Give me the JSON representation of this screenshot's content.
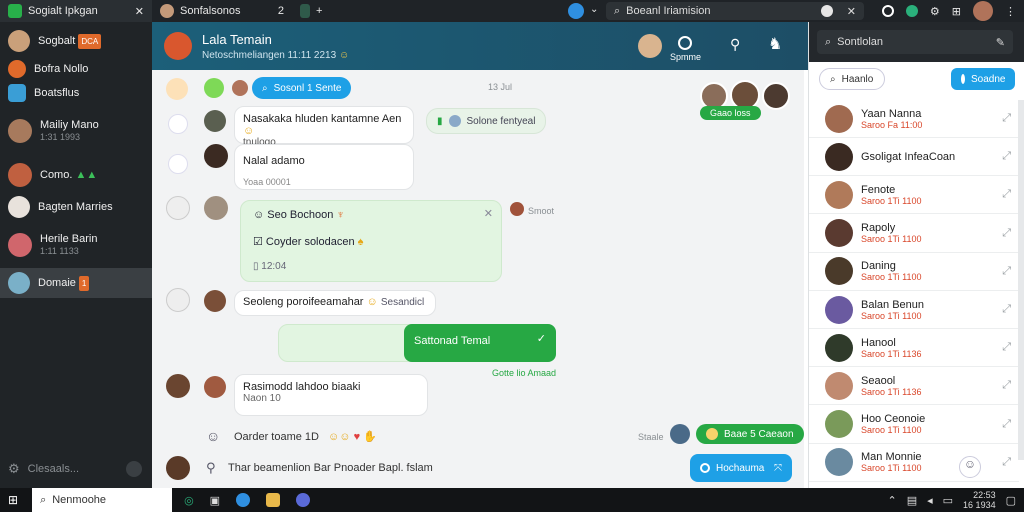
{
  "topbar": {
    "tabs": [
      {
        "label": "Sogialt Ipkgan",
        "close": "✕"
      },
      {
        "label": "Sonfalsonos",
        "num": "2"
      },
      {
        "label": "",
        "plus": "+"
      }
    ],
    "search": {
      "value": "Boeanl Iriamision"
    }
  },
  "sidebar": {
    "items": [
      {
        "name": "Sogbalt",
        "badge": "DCA",
        "sub": ""
      },
      {
        "name": "Bofra Nollo",
        "sub": ""
      },
      {
        "name": "Boatsflus",
        "sub": ""
      },
      {
        "name": "Mailiy Mano",
        "sub": "1:31 1993"
      },
      {
        "name": "Como.",
        "sub": ""
      },
      {
        "name": "Bagten Marries",
        "sub": ""
      },
      {
        "name": "Herile Barin",
        "sub": "1:11 1133"
      },
      {
        "name": "Domaie",
        "badge": "1",
        "sub": ""
      }
    ],
    "footer": "Clesaals...",
    "footer_icon": "gear-icon"
  },
  "chathead": {
    "title": "Lala Temain",
    "subtitle": "Netoschmeliangen 11:11 2213",
    "label": "Spmme"
  },
  "chat": {
    "search_pill": "Sosonl 1 Sente",
    "date": "13 Jul",
    "group_label": "Gaao loss",
    "bubble1": {
      "text": "Nasakaka hluden kantamne Aen",
      "sub": "tnulogo"
    },
    "pill2": "Solone fentyeal",
    "bubble2": {
      "text": "Nalal adamo",
      "meta": "Yoaa 00001"
    },
    "card": {
      "items": [
        "Seo Bochoon",
        "Coyder solodacen",
        "12:04"
      ],
      "side": "Smoot"
    },
    "bubble3": "Seoleng poroifeeamahar",
    "bubble3_tag": "Sesandicl",
    "green_out": "Sattonad Temal",
    "green_meta": "Gotte lio Amaad",
    "bubble4": {
      "text": "Rasimodd lahdoo biaaki",
      "sub": "Naon 10"
    },
    "reaction_row": "Oarder toame 1D",
    "reaction_meta": "Staale",
    "reaction_pill": "Baae 5 Caeaon",
    "compose": "Thar beamenlion  Bar Pnoader Bapl. fslam",
    "send": "Hochauma"
  },
  "right": {
    "search": "Sontlolan",
    "btn1": "Haanlo",
    "btn2": "Soadne",
    "items": [
      {
        "name": "Yaan Nanna",
        "status": "Saroo Fa 11:00"
      },
      {
        "name": "Gsoligat InfeaCoan",
        "status": ""
      },
      {
        "name": "Fenote",
        "status": "Saroo 1Ti 1100"
      },
      {
        "name": "Rapoly",
        "status": "Saroo 1Ti 1100"
      },
      {
        "name": "Daning",
        "status": "Saroo 1Ti 1100"
      },
      {
        "name": "Balan Benun",
        "status": "Saroo 1Ti 1100"
      },
      {
        "name": "Hanool",
        "status": "Saroo 1Ti 1136"
      },
      {
        "name": "Seaool",
        "status": "Saroo 1Ti 1136"
      },
      {
        "name": "Hoo Ceonoie",
        "status": "Saroo 1Ti 1100"
      },
      {
        "name": "Man Monnie",
        "status": "Saroo 1Ti 1100"
      }
    ]
  },
  "taskbar": {
    "search": "Nenmoohe",
    "time": "22:53",
    "date": "16 1934"
  },
  "colors": {
    "accent": "#1ea0e6",
    "green": "#27a844",
    "header": "#1c5f79"
  }
}
